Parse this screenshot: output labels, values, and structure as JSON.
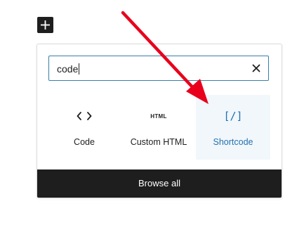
{
  "add_block": {
    "icon": "plus-icon"
  },
  "search": {
    "value": "code",
    "clear_icon": "close-icon"
  },
  "results": [
    {
      "label": "Code",
      "icon": "code-brackets-icon",
      "selected": false
    },
    {
      "label": "Custom HTML",
      "icon": "html-icon",
      "icon_text": "HTML",
      "selected": false
    },
    {
      "label": "Shortcode",
      "icon": "shortcode-icon",
      "icon_text": "[/]",
      "selected": true
    }
  ],
  "footer": {
    "browse_all_label": "Browse all"
  },
  "annotation": {
    "icon": "red-arrow-icon",
    "color": "#e8001c"
  },
  "colors": {
    "accent": "#2271b1",
    "dark": "#1e1e1e",
    "selected_bg": "#f1f7fb"
  }
}
